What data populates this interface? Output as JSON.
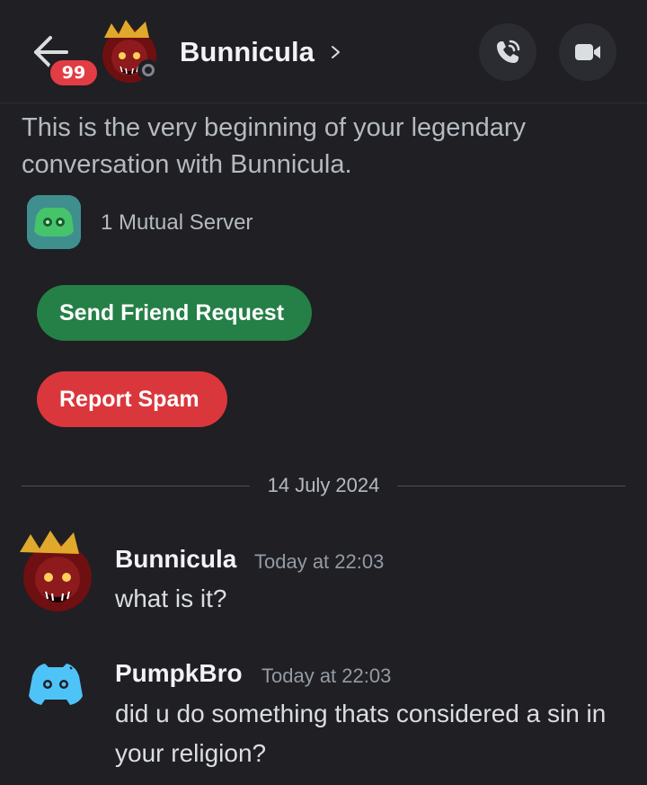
{
  "header": {
    "unread_badge": "99",
    "contact_name": "Bunnicula",
    "status": "offline"
  },
  "intro": {
    "text": "This is the very beginning of your legendary conversation with Bunnicula.",
    "mutual_servers": "1 Mutual Server"
  },
  "actions": {
    "friend_request": "Send Friend Request",
    "report_spam": "Report Spam"
  },
  "date_divider": "14 July 2024",
  "messages": [
    {
      "author": "Bunnicula",
      "timestamp": "Today at 22:03",
      "text": "what is it?"
    },
    {
      "author": "PumpkBro",
      "timestamp": "Today at 22:03",
      "text": "did u do something thats considered a sin in your religion?"
    }
  ],
  "colors": {
    "background": "#1f1f24",
    "badge": "#e23c44",
    "friend_button": "#248046",
    "spam_button": "#da373c",
    "discord_blurple": "#5865f2"
  },
  "icons": {
    "back": "arrow-left-icon",
    "call": "phone-call-icon",
    "video": "video-camera-icon",
    "chevron": "chevron-right-icon"
  }
}
